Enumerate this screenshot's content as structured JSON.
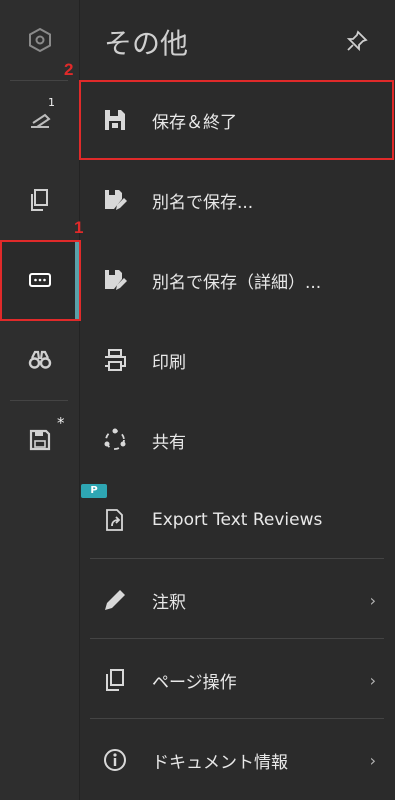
{
  "panel": {
    "title": "その他"
  },
  "rail": {
    "notifications_count": "1",
    "save_modified_marker": "*",
    "active_item": "more-options"
  },
  "callouts": {
    "callout_1_label": "1",
    "callout_2_label": "2"
  },
  "menu": [
    {
      "id": "save-and-close",
      "label": "保存＆終了",
      "icon": "save-icon",
      "chevron": ""
    },
    {
      "id": "save-as",
      "label": "別名で保存...",
      "icon": "save-as-icon",
      "chevron": ""
    },
    {
      "id": "save-as-detailed",
      "label": "別名で保存（詳細）...",
      "icon": "save-as-detailed-icon",
      "chevron": ""
    },
    {
      "id": "print",
      "label": "印刷",
      "icon": "printer-icon",
      "chevron": ""
    },
    {
      "id": "share",
      "label": "共有",
      "icon": "share-icon",
      "chevron": ""
    },
    {
      "id": "export-text-reviews",
      "label": "Export Text Reviews",
      "icon": "export-icon",
      "chevron": ""
    },
    {
      "id": "annotations",
      "label": "注釈",
      "icon": "pen-icon",
      "chevron": "›"
    },
    {
      "id": "page-operations",
      "label": "ページ操作",
      "icon": "pages-icon",
      "chevron": "›"
    },
    {
      "id": "document-info",
      "label": "ドキュメント情報",
      "icon": "info-icon",
      "chevron": "›"
    }
  ],
  "plugin_tag_text": "P",
  "colors": {
    "accent": "#5aa0a8",
    "callout": "#e02a2a",
    "plugin_tag": "#2ea6b3"
  }
}
